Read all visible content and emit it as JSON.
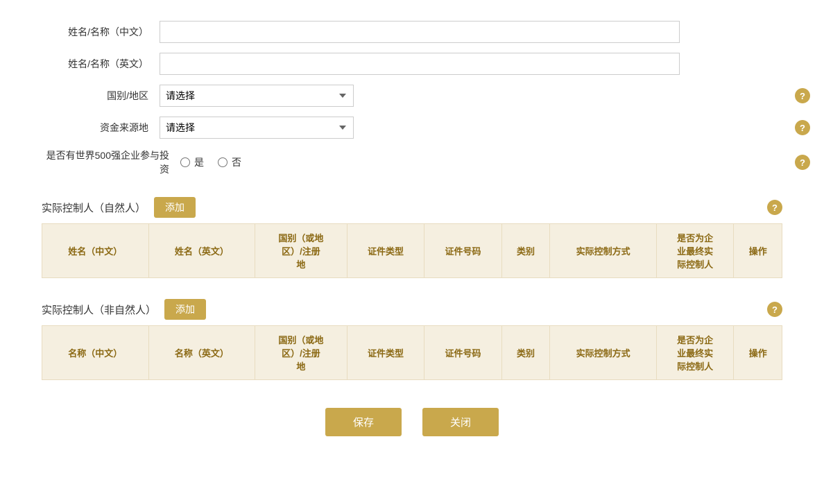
{
  "form": {
    "name_cn_label": "姓名/名称（中文）",
    "name_en_label": "姓名/名称（英文）",
    "country_label": "国别/地区",
    "fund_source_label": "资金来源地",
    "fortune500_label": "是否有世界500强企业参与投资",
    "yes_label": "是",
    "no_label": "否",
    "country_placeholder": "请选择",
    "fund_source_placeholder": "请选择",
    "name_cn_value": "",
    "name_en_value": ""
  },
  "section1": {
    "title": "实际控制人（自然人）",
    "add_label": "添加",
    "help_icon": "?",
    "columns": [
      "姓名（中文）",
      "姓名（英文）",
      "国别（或地\n区）/注册\n地",
      "证件类型",
      "证件号码",
      "类别",
      "实际控制方式",
      "是否为企\n业最终实\n际控制人",
      "操作"
    ]
  },
  "section2": {
    "title": "实际控制人（非自然人）",
    "add_label": "添加",
    "help_icon": "?",
    "columns": [
      "名称（中文）",
      "名称（英文）",
      "国别（或地\n区）/注册\n地",
      "证件类型",
      "证件号码",
      "类别",
      "实际控制方式",
      "是否为企\n业最终实\n际控制人",
      "操作"
    ]
  },
  "buttons": {
    "save_label": "保存",
    "close_label": "关闭"
  }
}
